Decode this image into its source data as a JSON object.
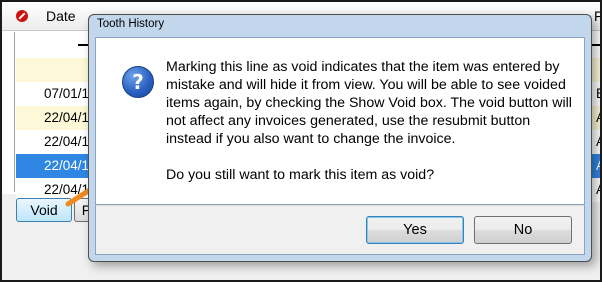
{
  "grid": {
    "header": {
      "date_col": "Date",
      "right_col": "F"
    },
    "rows": [
      {
        "date": "",
        "tail": "",
        "style": "blank"
      },
      {
        "date": "",
        "tail": "",
        "style": "yellow-empty"
      },
      {
        "date": "07/01/1",
        "tail": "E",
        "style": "white"
      },
      {
        "date": "22/04/1",
        "tail": "A",
        "style": "yellow"
      },
      {
        "date": "22/04/1",
        "tail": "A",
        "style": "white"
      },
      {
        "date": "22/04/1",
        "tail": "A",
        "style": "selected"
      },
      {
        "date": "22/04/1",
        "tail": "A",
        "style": "white"
      }
    ],
    "void_label": "Void",
    "other_label": "F"
  },
  "dialog": {
    "title": "Tooth History",
    "message": "Marking this line as void indicates that the item was entered by mistake and will hide it from view. You will be able to see voided items again, by checking the Show Void box. The void button will not affect any invoices generated, use the resubmit button instead if you also want to change the invoice.",
    "question": "Do you still want to mark this item as void?",
    "yes_label": "Yes",
    "no_label": "No",
    "icon": "question-icon"
  },
  "colors": {
    "selection": "#2f86e3",
    "yellow_row": "#fdf8d8",
    "arrow": "#f08a1e",
    "dialog_frame": "#c2d7ec"
  }
}
